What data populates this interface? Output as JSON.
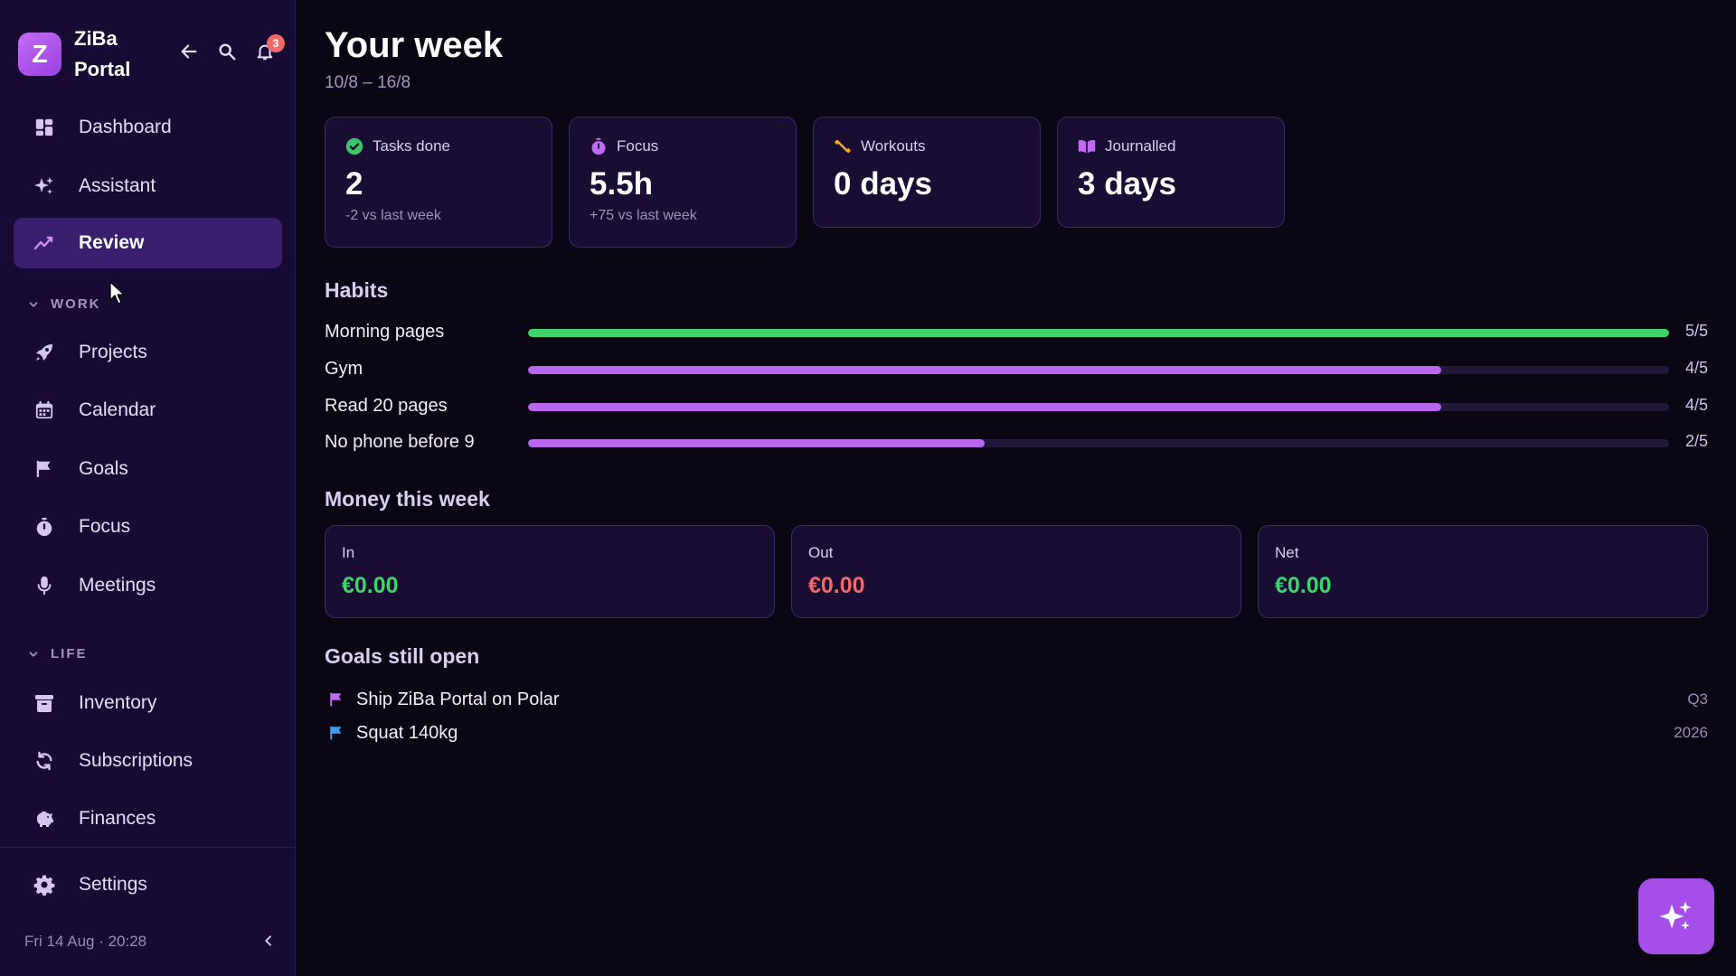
{
  "app": {
    "logo_letter": "Z",
    "name": "ZiBa Portal",
    "notification_count": "3"
  },
  "sidebar": {
    "items": [
      {
        "label": "Dashboard",
        "icon": "dashboard-icon"
      },
      {
        "label": "Assistant",
        "icon": "sparkles-icon"
      },
      {
        "label": "Review",
        "icon": "trend-icon",
        "active": true
      }
    ],
    "work_label": "WORK",
    "work_items": [
      {
        "label": "Projects",
        "icon": "rocket-icon"
      },
      {
        "label": "Calendar",
        "icon": "calendar-icon"
      },
      {
        "label": "Goals",
        "icon": "flag-icon"
      },
      {
        "label": "Focus",
        "icon": "stopwatch-icon"
      },
      {
        "label": "Meetings",
        "icon": "microphone-icon"
      }
    ],
    "life_label": "LIFE",
    "life_items": [
      {
        "label": "Inventory",
        "icon": "archive-box-icon"
      },
      {
        "label": "Subscriptions",
        "icon": "refresh-icon"
      },
      {
        "label": "Finances",
        "icon": "piggy-bank-icon"
      }
    ],
    "settings_label": "Settings",
    "datetime": "Fri 14 Aug · 20:28"
  },
  "main": {
    "title": "Your week",
    "date_range": "10/8 – 16/8",
    "stats": [
      {
        "label": "Tasks done",
        "value": "2",
        "sub": "-2 vs last week",
        "icon": "check-circle-icon",
        "color": "#3ec46d"
      },
      {
        "label": "Focus",
        "value": "5.5h",
        "sub": "+75 vs last week",
        "icon": "stopwatch-icon",
        "color": "#c06af2"
      },
      {
        "label": "Workouts",
        "value": "0 days",
        "sub": "",
        "icon": "dumbbell-icon",
        "color": "#f5a623"
      },
      {
        "label": "Journalled",
        "value": "3 days",
        "sub": "",
        "icon": "book-icon",
        "color": "#c06af2"
      }
    ],
    "habits_title": "Habits",
    "habits": [
      {
        "name": "Morning pages",
        "count": "5/5",
        "progress": 1.0,
        "color": "#3ed46c"
      },
      {
        "name": "Gym",
        "count": "4/5",
        "progress": 0.8,
        "color": "#b966ef"
      },
      {
        "name": "Read 20 pages",
        "count": "4/5",
        "progress": 0.8,
        "color": "#b966ef"
      },
      {
        "name": "No phone before 9",
        "count": "2/5",
        "progress": 0.4,
        "color": "#b966ef"
      }
    ],
    "money_title": "Money this week",
    "money": [
      {
        "label": "In",
        "value": "€0.00",
        "color": "#3ed46c"
      },
      {
        "label": "Out",
        "value": "€0.00",
        "color": "#f06a6a"
      },
      {
        "label": "Net",
        "value": "€0.00",
        "color": "#3ed46c"
      }
    ],
    "goals_title": "Goals still open",
    "goals": [
      {
        "text": "Ship ZiBa Portal on Polar",
        "meta": "Q3",
        "flag_color": "#c06af2"
      },
      {
        "text": "Squat 140kg",
        "meta": "2026",
        "flag_color": "#3f9bf2"
      }
    ]
  },
  "colors": {
    "accent": "#a54ee8",
    "sidebar_bg": "#170a33",
    "main_bg": "#0b0614",
    "card_bg": "#1a0d33",
    "active_item_bg": "#3a1f6e"
  }
}
